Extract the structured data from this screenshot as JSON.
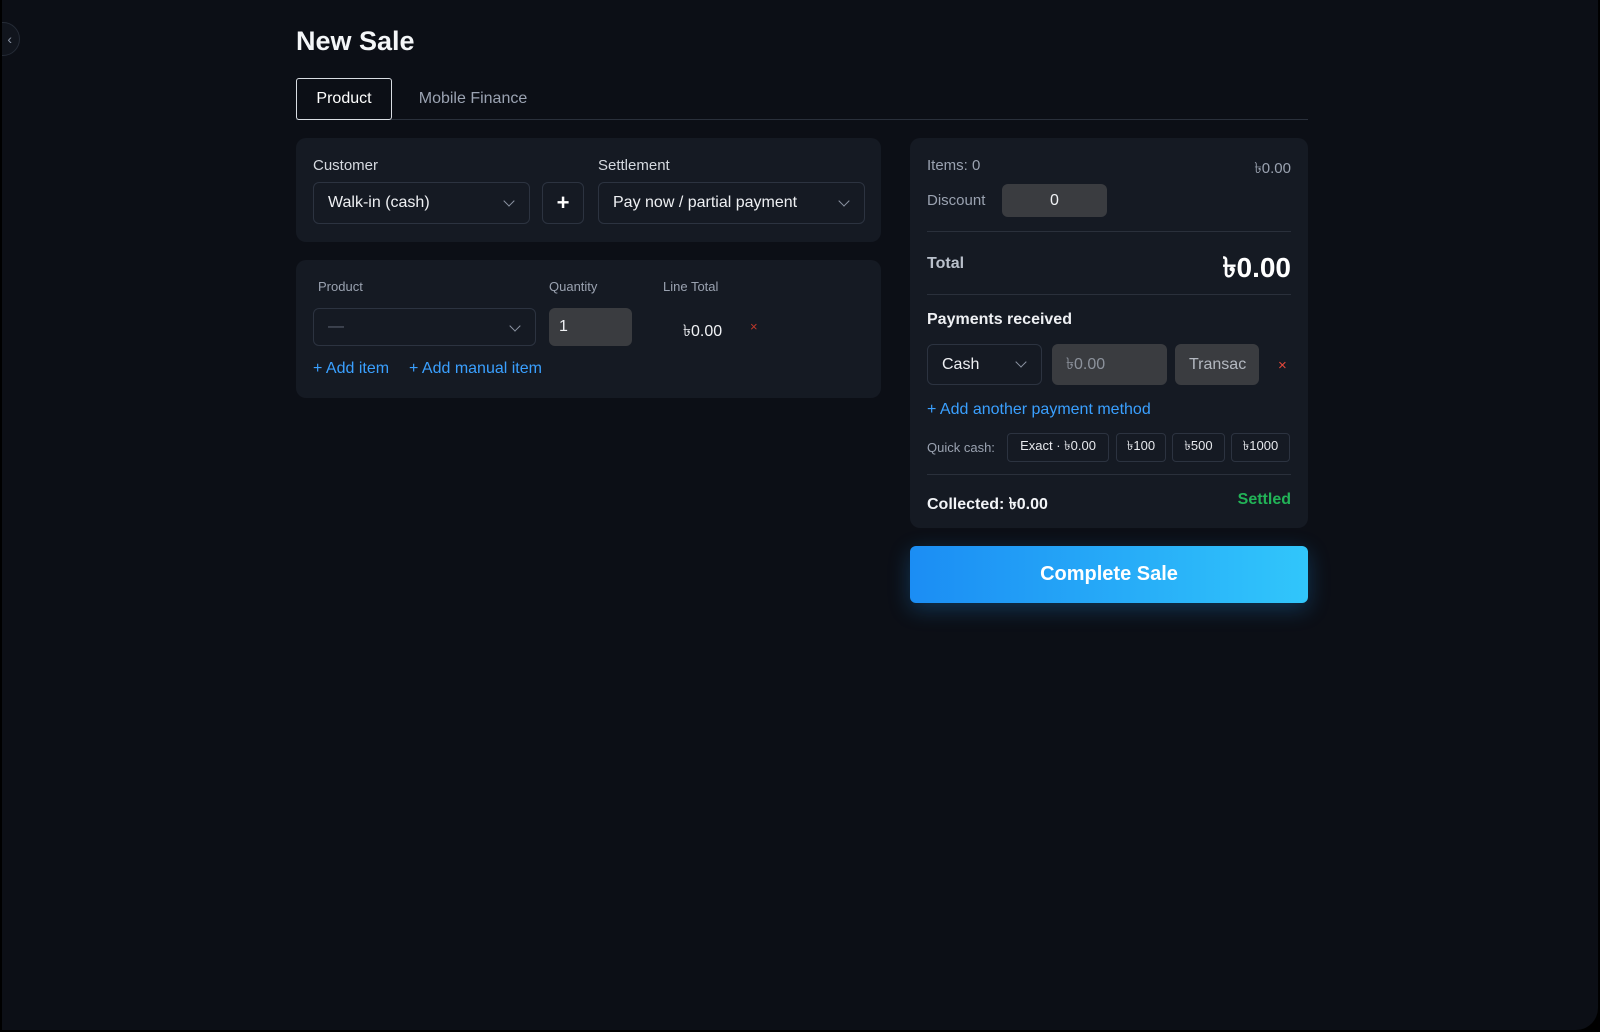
{
  "page": {
    "title": "New Sale"
  },
  "tabs": [
    {
      "label": "Product",
      "active": true
    },
    {
      "label": "Mobile Finance",
      "active": false
    }
  ],
  "customer": {
    "label": "Customer",
    "value": "Walk-in (cash)",
    "add_icon": "plus-icon"
  },
  "settlement": {
    "label": "Settlement",
    "value": "Pay now / partial payment"
  },
  "items": {
    "headers": {
      "product": "Product",
      "quantity": "Quantity",
      "line_total": "Line Total"
    },
    "row": {
      "product": "—",
      "quantity": "1",
      "line_total": "৳0.00",
      "remove": "×"
    },
    "add_item": "+ Add item",
    "add_manual_item": "+ Add manual item"
  },
  "summary": {
    "items_label": "Items: 0",
    "items_amount": "৳0.00",
    "discount_label": "Discount",
    "discount_value": "0",
    "total_label": "Total",
    "total_value": "৳0.00",
    "payments_title": "Payments received",
    "payment_method": "Cash",
    "amount_placeholder": "৳0.00",
    "transaction_placeholder": "Transac",
    "remove": "×",
    "add_payment": "+ Add another payment method",
    "quick_cash_label": "Quick cash:",
    "quick_cash": [
      "Exact · ৳0.00",
      "৳100",
      "৳500",
      "৳1000"
    ],
    "collected": "Collected: ৳0.00",
    "status": "Settled"
  },
  "actions": {
    "complete": "Complete Sale"
  },
  "colors": {
    "background": "#0c0f16",
    "card": "#151a23",
    "accent": "#3aa0ff",
    "success": "#22b357",
    "danger": "#e5483b"
  }
}
